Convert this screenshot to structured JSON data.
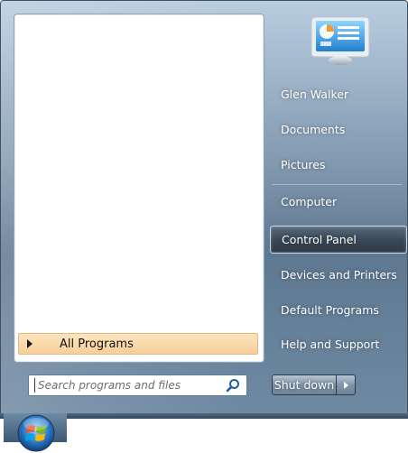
{
  "start_menu": {
    "all_programs_label": "All Programs",
    "search_placeholder": "Search programs and files",
    "search_icon": "magnifier-icon",
    "user_tile_icon": "control-panel-picture-icon",
    "right_items": [
      {
        "label": "Glen Walker"
      },
      {
        "label": "Documents"
      },
      {
        "label": "Pictures"
      },
      {
        "label": "Computer"
      },
      {
        "label": "Control Panel",
        "highlighted": true
      },
      {
        "label": "Devices and Printers"
      },
      {
        "label": "Default Programs"
      },
      {
        "label": "Help and Support"
      }
    ],
    "shutdown_label": "Shut down"
  },
  "taskbar": {
    "start_orb_icon": "windows-start-orb-icon"
  },
  "colors": {
    "highlight_orange": "#f7cf9a",
    "pane_blue": "#7f98ae"
  }
}
